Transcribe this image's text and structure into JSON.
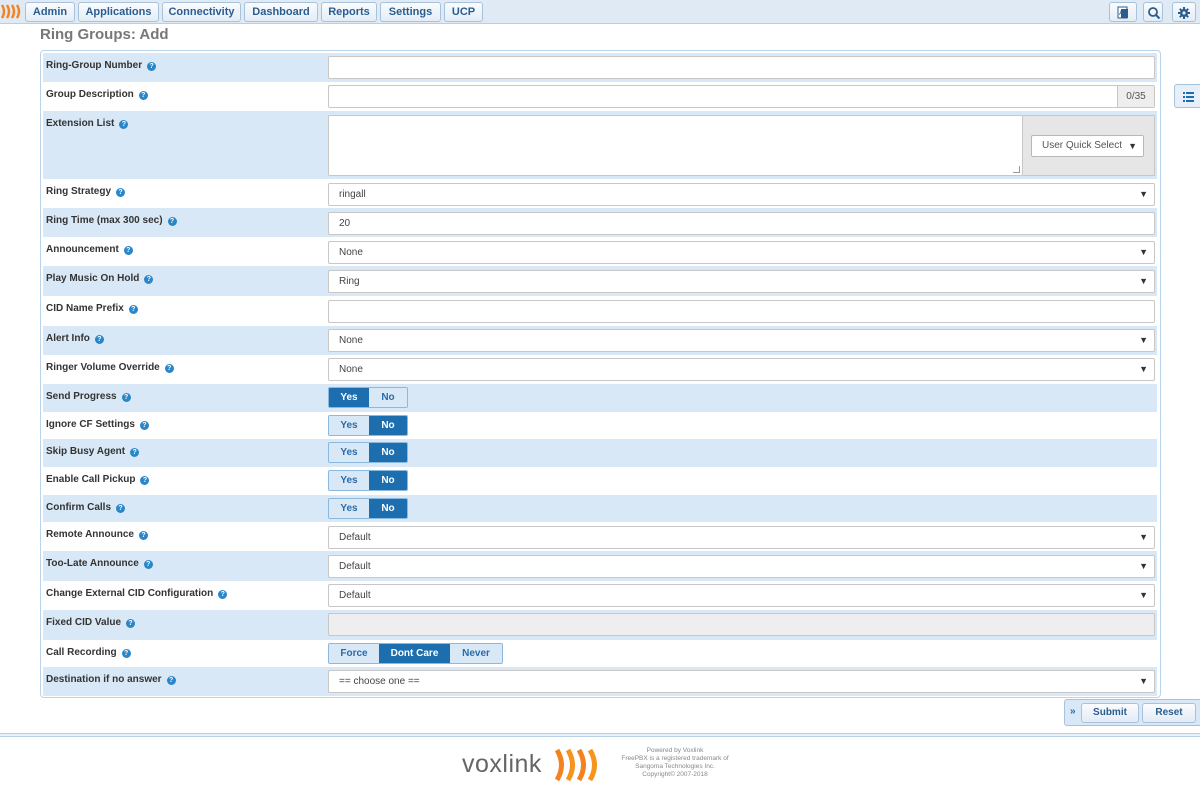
{
  "nav": {
    "items": [
      "Admin",
      "Applications",
      "Connectivity",
      "Dashboard",
      "Reports",
      "Settings",
      "UCP"
    ]
  },
  "page_title": "Ring Groups: Add",
  "form": {
    "ring_group_number": {
      "label": "Ring-Group Number",
      "value": ""
    },
    "group_description": {
      "label": "Group Description",
      "value": "",
      "counter": "0/35"
    },
    "extension_list": {
      "label": "Extension List",
      "value": "",
      "quick_select": "User Quick Select"
    },
    "ring_strategy": {
      "label": "Ring Strategy",
      "value": "ringall"
    },
    "ring_time": {
      "label": "Ring Time (max 300 sec)",
      "value": "20"
    },
    "announcement": {
      "label": "Announcement",
      "value": "None"
    },
    "play_moh": {
      "label": "Play Music On Hold",
      "value": "Ring"
    },
    "cid_name_prefix": {
      "label": "CID Name Prefix",
      "value": ""
    },
    "alert_info": {
      "label": "Alert Info",
      "value": "None"
    },
    "ringer_volume": {
      "label": "Ringer Volume Override",
      "value": "None"
    },
    "send_progress": {
      "label": "Send Progress",
      "yes": "Yes",
      "no": "No",
      "selected": "Yes"
    },
    "ignore_cf": {
      "label": "Ignore CF Settings",
      "yes": "Yes",
      "no": "No",
      "selected": "No"
    },
    "skip_busy": {
      "label": "Skip Busy Agent",
      "yes": "Yes",
      "no": "No",
      "selected": "No"
    },
    "call_pickup": {
      "label": "Enable Call Pickup",
      "yes": "Yes",
      "no": "No",
      "selected": "No"
    },
    "confirm_calls": {
      "label": "Confirm Calls",
      "yes": "Yes",
      "no": "No",
      "selected": "No"
    },
    "remote_announce": {
      "label": "Remote Announce",
      "value": "Default"
    },
    "too_late_announce": {
      "label": "Too-Late Announce",
      "value": "Default"
    },
    "change_ext_cid": {
      "label": "Change External CID Configuration",
      "value": "Default"
    },
    "fixed_cid": {
      "label": "Fixed CID Value",
      "value": ""
    },
    "call_recording": {
      "label": "Call Recording",
      "options": [
        "Force",
        "Dont Care",
        "Never"
      ],
      "selected": "Dont Care"
    },
    "destination": {
      "label": "Destination if no answer",
      "value": "== choose one =="
    }
  },
  "actions": {
    "submit": "Submit",
    "reset": "Reset",
    "toggle_symbol": "»"
  },
  "footer": {
    "brand": "voxlink",
    "lines": [
      "Powered by Voxlink",
      "FreePBX is a registered trademark of",
      "Sangoma Technologies Inc.",
      "Copyright© 2007-2018"
    ]
  },
  "colors": {
    "accent": "#1c6eae",
    "row_shade": "#d9e8f6",
    "brand_orange": "#f58220"
  },
  "icons": {
    "help": "?",
    "select_arrow": "▼"
  }
}
